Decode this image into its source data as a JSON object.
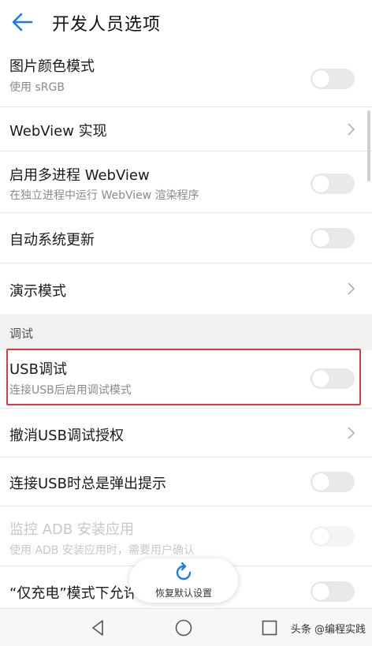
{
  "header": {
    "title": "开发人员选项"
  },
  "rows": [
    {
      "title": "图片颜色模式",
      "subtitle": "使用 sRGB"
    },
    {
      "title": "WebView 实现"
    },
    {
      "title": "启用多进程 WebView",
      "subtitle": "在独立进程中运行 WebView 渲染程序"
    },
    {
      "title": "自动系统更新"
    },
    {
      "title": "演示模式"
    },
    {
      "title": "USB调试",
      "subtitle": "连接USB后启用调试模式"
    },
    {
      "title": "撤消USB调试授权"
    },
    {
      "title": "连接USB时总是弹出提示"
    },
    {
      "title": "监控 ADB 安装应用",
      "subtitle": "使用 ADB 安装应用时，需要用户确认"
    },
    {
      "title": "“仅充电”模式下允许"
    }
  ],
  "section": {
    "label": "调试"
  },
  "restore": {
    "label": "恢复默认设置"
  },
  "watermark": "头条 @编程实践",
  "colors": {
    "accent": "#1a7cf0",
    "highlight": "#e0383e"
  },
  "icons": {
    "back": "arrow-left-icon",
    "chevron": "chevron-right-icon",
    "restore": "refresh-icon",
    "nav_back": "triangle-back-icon",
    "nav_home": "circle-home-icon",
    "nav_recent": "square-recent-icon"
  },
  "toggles": {
    "color_mode": false,
    "multiprocess": false,
    "auto_update": false,
    "usb_debug": false,
    "usb_prompt": false,
    "adb_monitor": false,
    "charge_only": false
  }
}
